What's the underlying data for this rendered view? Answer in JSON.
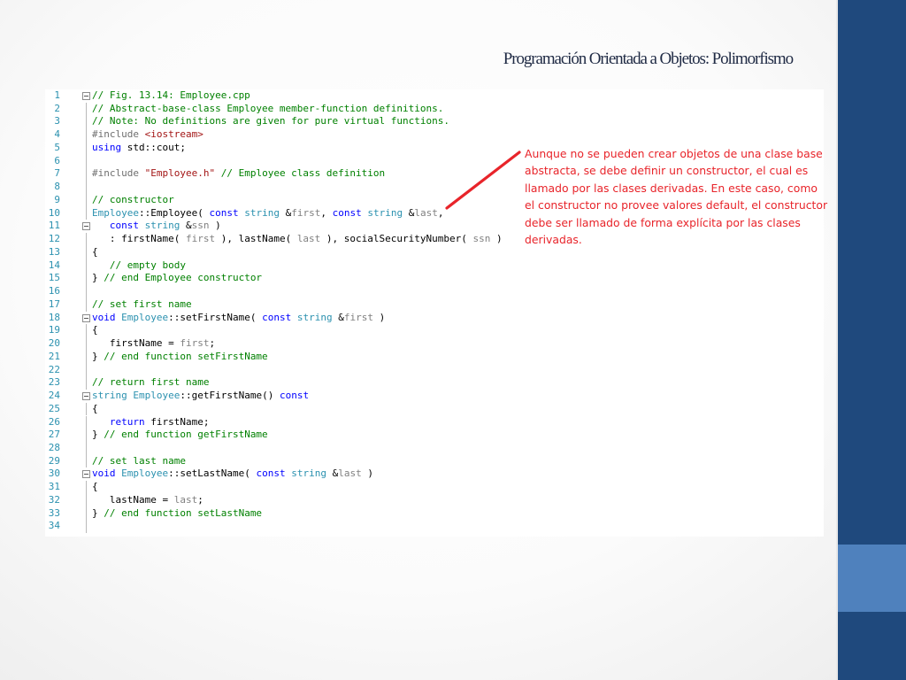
{
  "slide": {
    "title": "Programación Orientada a Objetos: Polimorfismo",
    "note": "Aunque no se pueden crear objetos de una clase base abstracta, se debe definir un constructor, el cual es llamado por las clases derivadas. En este caso, como el constructor no provee valores default, el constructor debe ser llamado de forma explícita por las clases derivadas."
  },
  "colors": {
    "accent_dark": "#1f497d",
    "accent_light": "#4f81bd",
    "note_red": "#e8242a",
    "comment_green": "#008000",
    "keyword_blue": "#0000ff",
    "type_teal": "#2b91af"
  },
  "code": {
    "lines": [
      {
        "n": "1",
        "fold": true,
        "parts": [
          {
            "t": "// Fig. 13.14: Employee.cpp",
            "c": "comment"
          }
        ]
      },
      {
        "n": "2",
        "parts": [
          {
            "t": "// Abstract-base-class Employee member-function definitions.",
            "c": "comment"
          }
        ]
      },
      {
        "n": "3",
        "parts": [
          {
            "t": "// Note: No definitions are given for pure virtual functions.",
            "c": "comment"
          }
        ]
      },
      {
        "n": "4",
        "parts": [
          {
            "t": "#include ",
            "c": "pp"
          },
          {
            "t": "<iostream>",
            "c": "str"
          }
        ]
      },
      {
        "n": "5",
        "parts": [
          {
            "t": "using",
            "c": "kw"
          },
          {
            "t": " std::cout;",
            "c": ""
          }
        ]
      },
      {
        "n": "6",
        "parts": []
      },
      {
        "n": "7",
        "parts": [
          {
            "t": "#include ",
            "c": "pp"
          },
          {
            "t": "\"Employee.h\"",
            "c": "str"
          },
          {
            "t": " // Employee class definition",
            "c": "comment"
          }
        ]
      },
      {
        "n": "8",
        "parts": []
      },
      {
        "n": "9",
        "parts": [
          {
            "t": "// constructor",
            "c": "comment"
          }
        ]
      },
      {
        "n": "10",
        "parts": [
          {
            "t": "Employee",
            "c": "type"
          },
          {
            "t": "::Employee( ",
            "c": ""
          },
          {
            "t": "const",
            "c": "kw"
          },
          {
            "t": " ",
            "c": ""
          },
          {
            "t": "string",
            "c": "type"
          },
          {
            "t": " &",
            "c": ""
          },
          {
            "t": "first",
            "c": "param"
          },
          {
            "t": ", ",
            "c": ""
          },
          {
            "t": "const",
            "c": "kw"
          },
          {
            "t": " ",
            "c": ""
          },
          {
            "t": "string",
            "c": "type"
          },
          {
            "t": " &",
            "c": ""
          },
          {
            "t": "last",
            "c": "param"
          },
          {
            "t": ",",
            "c": ""
          }
        ]
      },
      {
        "n": "11",
        "fold": true,
        "parts": [
          {
            "t": "   ",
            "c": ""
          },
          {
            "t": "const",
            "c": "kw"
          },
          {
            "t": " ",
            "c": ""
          },
          {
            "t": "string",
            "c": "type"
          },
          {
            "t": " &",
            "c": ""
          },
          {
            "t": "ssn",
            "c": "param"
          },
          {
            "t": " )",
            "c": ""
          }
        ]
      },
      {
        "n": "12",
        "parts": [
          {
            "t": "   : firstName( ",
            "c": ""
          },
          {
            "t": "first",
            "c": "param"
          },
          {
            "t": " ), lastName( ",
            "c": ""
          },
          {
            "t": "last",
            "c": "param"
          },
          {
            "t": " ), socialSecurityNumber( ",
            "c": ""
          },
          {
            "t": "ssn",
            "c": "param"
          },
          {
            "t": " )",
            "c": ""
          }
        ]
      },
      {
        "n": "13",
        "parts": [
          {
            "t": "{",
            "c": ""
          }
        ]
      },
      {
        "n": "14",
        "parts": [
          {
            "t": "   // empty body",
            "c": "comment"
          }
        ]
      },
      {
        "n": "15",
        "parts": [
          {
            "t": "} ",
            "c": ""
          },
          {
            "t": "// end Employee constructor",
            "c": "comment"
          }
        ]
      },
      {
        "n": "16",
        "parts": []
      },
      {
        "n": "17",
        "parts": [
          {
            "t": "// set first name",
            "c": "comment"
          }
        ]
      },
      {
        "n": "18",
        "fold": true,
        "parts": [
          {
            "t": "void",
            "c": "kw"
          },
          {
            "t": " ",
            "c": ""
          },
          {
            "t": "Employee",
            "c": "type"
          },
          {
            "t": "::setFirstName( ",
            "c": ""
          },
          {
            "t": "const",
            "c": "kw"
          },
          {
            "t": " ",
            "c": ""
          },
          {
            "t": "string",
            "c": "type"
          },
          {
            "t": " &",
            "c": ""
          },
          {
            "t": "first",
            "c": "param"
          },
          {
            "t": " )",
            "c": ""
          }
        ]
      },
      {
        "n": "19",
        "parts": [
          {
            "t": "{",
            "c": ""
          }
        ]
      },
      {
        "n": "20",
        "parts": [
          {
            "t": "   firstName = ",
            "c": ""
          },
          {
            "t": "first",
            "c": "param"
          },
          {
            "t": ";",
            "c": ""
          }
        ]
      },
      {
        "n": "21",
        "parts": [
          {
            "t": "} ",
            "c": ""
          },
          {
            "t": "// end function setFirstName",
            "c": "comment"
          }
        ]
      },
      {
        "n": "22",
        "parts": []
      },
      {
        "n": "23",
        "parts": [
          {
            "t": "// return first name",
            "c": "comment"
          }
        ]
      },
      {
        "n": "24",
        "fold": true,
        "parts": [
          {
            "t": "string",
            "c": "type"
          },
          {
            "t": " ",
            "c": ""
          },
          {
            "t": "Employee",
            "c": "type"
          },
          {
            "t": "::getFirstName() ",
            "c": ""
          },
          {
            "t": "const",
            "c": "kw"
          }
        ]
      },
      {
        "n": "25",
        "parts": [
          {
            "t": "{",
            "c": ""
          }
        ]
      },
      {
        "n": "26",
        "parts": [
          {
            "t": "   ",
            "c": ""
          },
          {
            "t": "return",
            "c": "kw"
          },
          {
            "t": " firstName;",
            "c": ""
          }
        ]
      },
      {
        "n": "27",
        "parts": [
          {
            "t": "} ",
            "c": ""
          },
          {
            "t": "// end function getFirstName",
            "c": "comment"
          }
        ]
      },
      {
        "n": "28",
        "parts": []
      },
      {
        "n": "29",
        "parts": [
          {
            "t": "// set last name",
            "c": "comment"
          }
        ]
      },
      {
        "n": "30",
        "fold": true,
        "parts": [
          {
            "t": "void",
            "c": "kw"
          },
          {
            "t": " ",
            "c": ""
          },
          {
            "t": "Employee",
            "c": "type"
          },
          {
            "t": "::setLastName( ",
            "c": ""
          },
          {
            "t": "const",
            "c": "kw"
          },
          {
            "t": " ",
            "c": ""
          },
          {
            "t": "string",
            "c": "type"
          },
          {
            "t": " &",
            "c": ""
          },
          {
            "t": "last",
            "c": "param"
          },
          {
            "t": " )",
            "c": ""
          }
        ]
      },
      {
        "n": "31",
        "parts": [
          {
            "t": "{",
            "c": ""
          }
        ]
      },
      {
        "n": "32",
        "parts": [
          {
            "t": "   lastName = ",
            "c": ""
          },
          {
            "t": "last",
            "c": "param"
          },
          {
            "t": ";",
            "c": ""
          }
        ]
      },
      {
        "n": "33",
        "parts": [
          {
            "t": "} ",
            "c": ""
          },
          {
            "t": "// end function setLastName",
            "c": "comment"
          }
        ]
      },
      {
        "n": "34",
        "parts": []
      }
    ]
  }
}
